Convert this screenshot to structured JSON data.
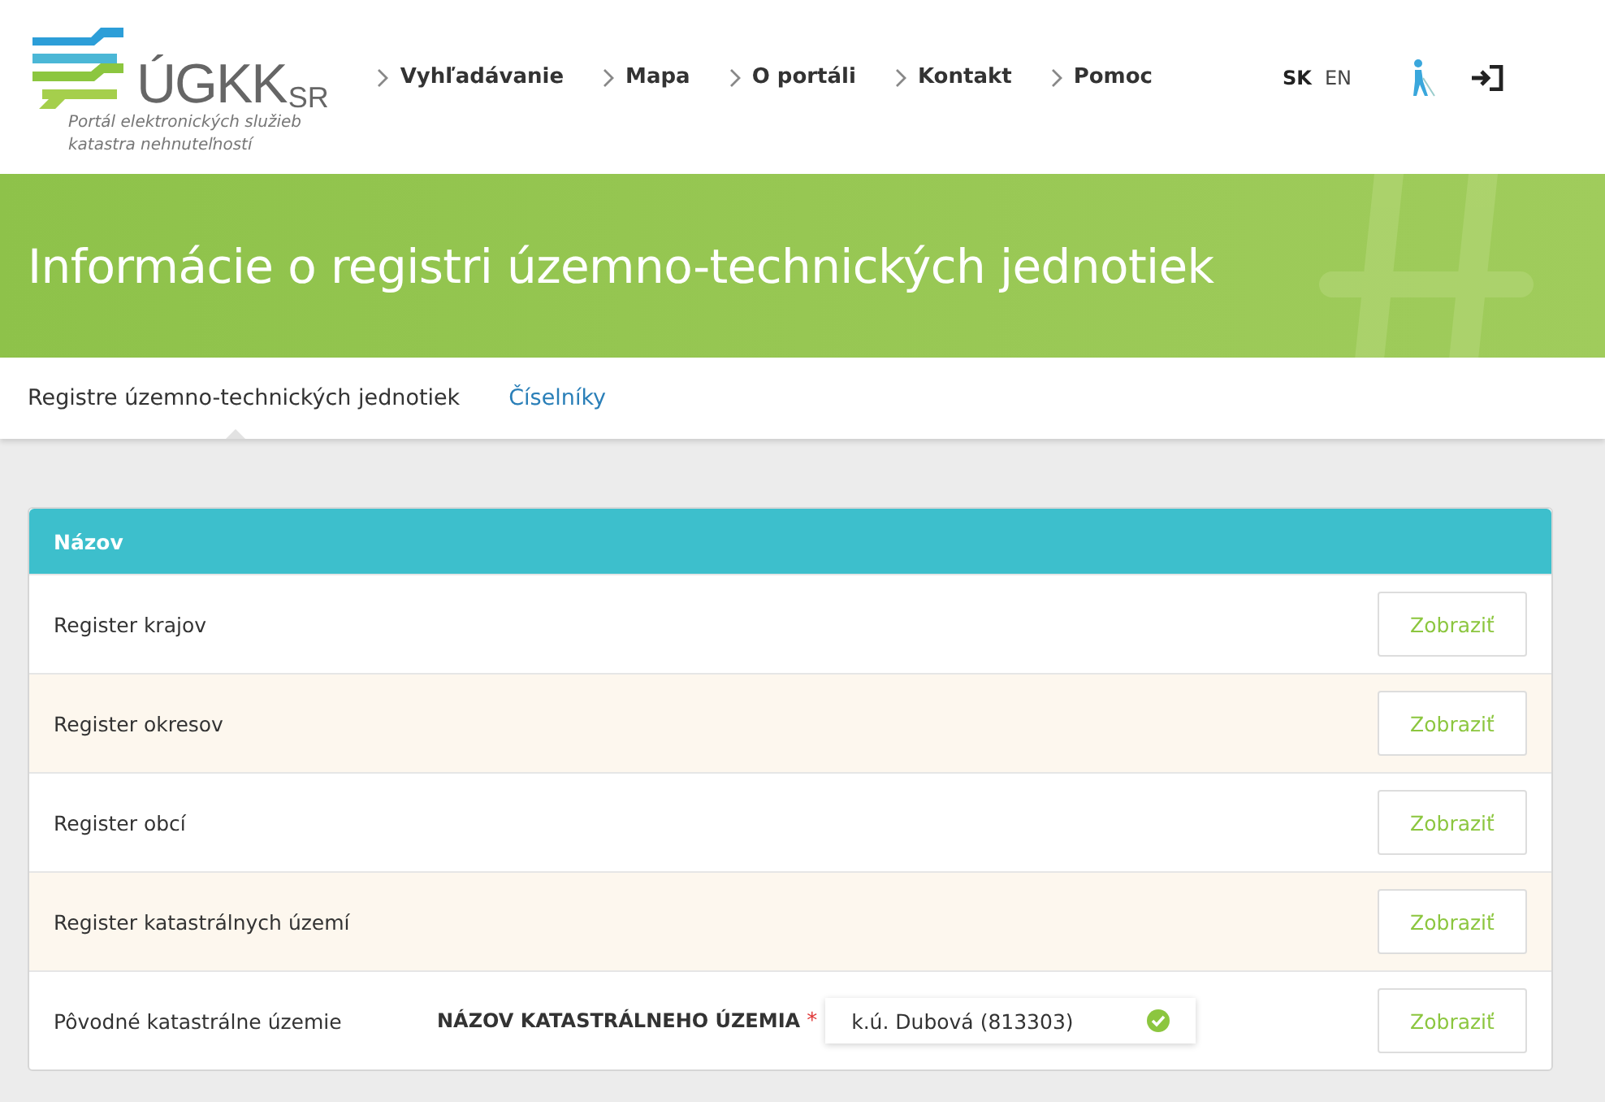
{
  "header": {
    "logo_text": "ÚGKK",
    "logo_suffix": "SR",
    "tagline_lines": [
      "Portál elektronických služieb",
      "katastra nehnuteľností"
    ],
    "nav": [
      {
        "label": "Vyhľadávanie"
      },
      {
        "label": "Mapa"
      },
      {
        "label": "O portáli"
      },
      {
        "label": "Kontakt"
      },
      {
        "label": "Pomoc"
      }
    ],
    "languages": [
      {
        "label": "SK",
        "selected": true
      },
      {
        "label": "EN",
        "selected": false
      }
    ]
  },
  "banner": {
    "title": "Informácie o registri územno-technických jednotiek"
  },
  "tabs": [
    {
      "label": "Registre územno-technických jednotiek",
      "selected": true
    },
    {
      "label": "Číselníky",
      "selected": false
    }
  ],
  "table": {
    "column": "Názov",
    "rows": [
      {
        "name": "Register krajov",
        "button": "Zobraziť"
      },
      {
        "name": "Register okresov",
        "button": "Zobraziť"
      },
      {
        "name": "Register obcí",
        "button": "Zobraziť"
      },
      {
        "name": "Register katastrálnych území",
        "button": "Zobraziť"
      },
      {
        "name": "Pôvodné katastrálne územie",
        "button": "Zobraziť",
        "field": {
          "label": "NÁZOV KATASTRÁLNEHO ÚZEMIA",
          "required_mark": "*",
          "value": "k.ú. Dubová (813303)",
          "valid": true
        }
      }
    ]
  }
}
